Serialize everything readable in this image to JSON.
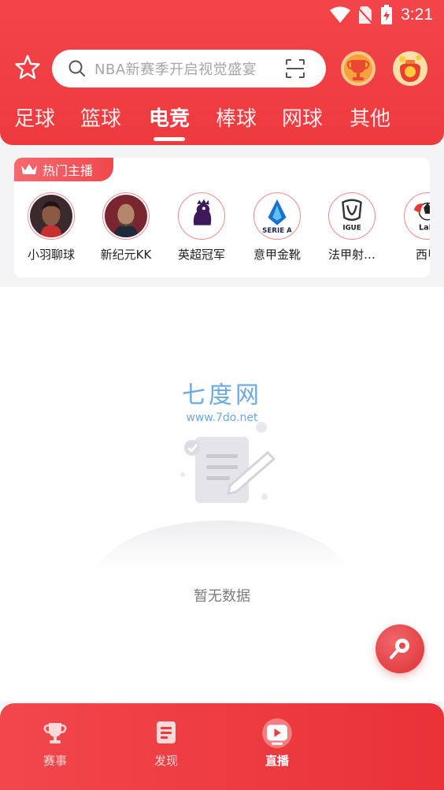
{
  "status_bar": {
    "time": "3:21"
  },
  "search": {
    "placeholder": "NBA新赛季开启视觉盛宴"
  },
  "tabs": [
    {
      "label": "足球",
      "active": false
    },
    {
      "label": "篮球",
      "active": false
    },
    {
      "label": "电竞",
      "active": true
    },
    {
      "label": "棒球",
      "active": false
    },
    {
      "label": "网球",
      "active": false
    },
    {
      "label": "其他",
      "active": false
    }
  ],
  "hot_section": {
    "title": "热门主播",
    "anchors": [
      {
        "name": "小羽聊球",
        "icon": "player-avatar"
      },
      {
        "name": "新纪元KK",
        "icon": "player-avatar"
      },
      {
        "name": "英超冠军",
        "icon": "premier-league-logo"
      },
      {
        "name": "意甲金靴",
        "icon": "serie-a-logo"
      },
      {
        "name": "法甲射…",
        "icon": "ligue-1-logo"
      },
      {
        "name": "西甲",
        "icon": "laliga-logo"
      }
    ]
  },
  "watermark": {
    "title": "七度网",
    "url": "www.7do.net"
  },
  "empty_state": {
    "text": "暂无数据"
  },
  "bottom_nav": [
    {
      "label": "赛事",
      "icon": "trophy-icon",
      "active": false
    },
    {
      "label": "发现",
      "icon": "document-icon",
      "active": false
    },
    {
      "label": "直播",
      "icon": "play-icon",
      "active": true
    }
  ],
  "colors": {
    "brand": "#ee3a3f",
    "accent_blue": "#6aa9e6"
  }
}
